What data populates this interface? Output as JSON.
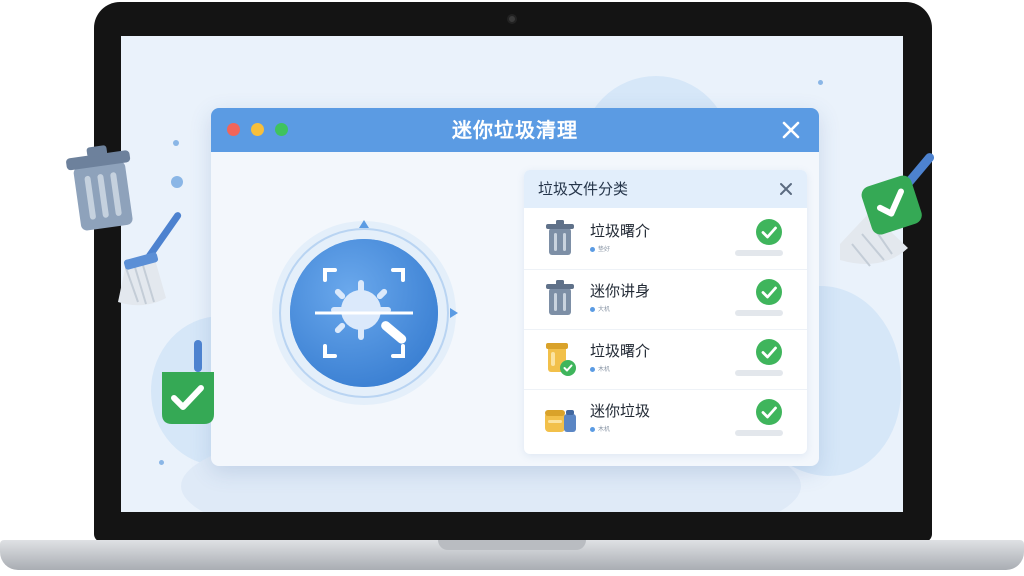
{
  "app": {
    "title": "迷你垃圾清理"
  },
  "panel": {
    "title": "垃圾文件分类",
    "rows": [
      {
        "label": "垃圾曙介",
        "meta": "垫好",
        "icon": "trash-can-icon",
        "checked": true
      },
      {
        "label": "迷你讲身",
        "meta": "大机",
        "icon": "trash-can-icon",
        "checked": true
      },
      {
        "label": "垃圾曙介",
        "meta": "木机",
        "icon": "cache-jar-icon",
        "checked": true
      },
      {
        "label": "迷你垃圾",
        "meta": "木机",
        "icon": "storage-jar-icon",
        "checked": true
      }
    ]
  },
  "colors": {
    "accent": "#5b9be3",
    "check": "#3fb55c",
    "screen_bg": "#eaf2fb"
  }
}
